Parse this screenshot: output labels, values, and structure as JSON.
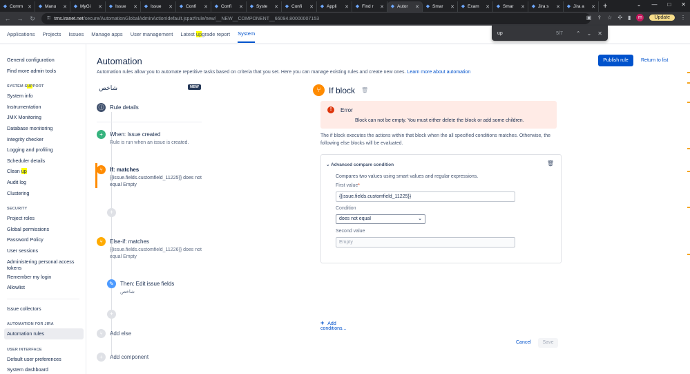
{
  "browser": {
    "tabs": [
      {
        "label": "Comm",
        "active": false
      },
      {
        "label": "Manu",
        "active": false
      },
      {
        "label": "MyGi",
        "active": false
      },
      {
        "label": "Issue",
        "active": false
      },
      {
        "label": "Issue",
        "active": false
      },
      {
        "label": "Confi",
        "active": false
      },
      {
        "label": "Confi",
        "active": false
      },
      {
        "label": "Syste",
        "active": false
      },
      {
        "label": "Confi",
        "active": false
      },
      {
        "label": "Appli",
        "active": false
      },
      {
        "label": "Find r",
        "active": false
      },
      {
        "label": "Autor",
        "active": true
      },
      {
        "label": "Smar",
        "active": false
      },
      {
        "label": "Exam",
        "active": false
      },
      {
        "label": "Smar",
        "active": false
      },
      {
        "label": "Jira s",
        "active": false
      },
      {
        "label": "Jira a",
        "active": false
      }
    ],
    "url_host": "tms.iranet.net",
    "url_path": "/secure/AutomationGlobalAdminAction!default.jspa#/rule/new/__NEW__COMPONENT__66094.80000007153",
    "profile_initial": "m",
    "update_label": "Update",
    "find": {
      "query": "up",
      "count": "5/7"
    }
  },
  "topnav": {
    "items": [
      {
        "pre": "Applications",
        "hl": "",
        "post": ""
      },
      {
        "pre": "Projects",
        "hl": "",
        "post": ""
      },
      {
        "pre": "Issues",
        "hl": "",
        "post": ""
      },
      {
        "pre": "Manage apps",
        "hl": "",
        "post": ""
      },
      {
        "pre": "User management",
        "hl": "",
        "post": ""
      },
      {
        "pre": "Latest ",
        "hl": "up",
        "post": "grade report"
      },
      {
        "pre": "System",
        "hl": "",
        "post": ""
      }
    ]
  },
  "sidebar": {
    "general_configuration": "General configuration",
    "find_more_admin_tools": "Find more admin tools",
    "system_support_pre": "SYSTEM S",
    "system_support_hl": "UP",
    "system_support_post": "PORT",
    "support_items": [
      "System info",
      "Instrumentation",
      "JMX Monitoring",
      "Database monitoring",
      "Integrity checker",
      "Logging and profiling",
      "Scheduler details"
    ],
    "clean_up_pre": "Clean ",
    "clean_up_hl": "up",
    "support_items_2": [
      "Audit log",
      "Clustering"
    ],
    "security_header": "SECURITY",
    "security_items": [
      "Project roles",
      "Global permissions",
      "Password Policy",
      "User sessions"
    ],
    "admin_personal_tokens": "Administering personal access tokens",
    "security_items_2": [
      "Remember my login",
      "Allowlist"
    ],
    "issue_collectors": "Issue collectors",
    "automation_header": "AUTOMATION FOR JIRA",
    "automation_rules": "Automation rules",
    "ui_header": "USER INTERFACE",
    "ui_items": [
      "Default user preferences",
      "System dashboard"
    ]
  },
  "main": {
    "title": "Automation",
    "description": "Automation rules allow you to automate repetitive tasks based on criteria that you set. Here you can manage existing rules and create new ones.",
    "learn_more": "Learn more about automation",
    "publish_label": "Publish rule",
    "return_label": "Return to list",
    "rule_name": "شاخص",
    "new_badge": "NEW",
    "rule_details": "Rule details",
    "trigger_title": "When: Issue created",
    "trigger_desc": "Rule is run when an issue is created.",
    "if_title": "If: matches",
    "if_desc": "{{issue.fields.customfield_11225}} does not equal Empty",
    "elseif_title": "Else-if: matches",
    "elseif_desc": "{{issue.fields.customfield_11226}} does not equal Empty",
    "then_title": "Then: Edit issue fields",
    "then_desc": "شاخص",
    "add_else": "Add else",
    "add_component": "Add component"
  },
  "panel": {
    "title": "If block",
    "error_title": "Error",
    "error_msg": "Block can not be empty. You must either delete the block or add some children.",
    "desc": "The if block executes the actions within that block when the all specified conditions matches. Otherwise, the following else blocks will be evaluated.",
    "cond_title": "Advanced compare condition",
    "cond_desc": "Compares two values using smart values and regular expressions.",
    "first_value_label": "First value",
    "first_value": "{{issue.fields.customfield_11225}}",
    "condition_label": "Condition",
    "condition_value": "does not equal",
    "second_value_label": "Second value",
    "second_value_placeholder": "Empty",
    "add_conditions": "Add conditions...",
    "cancel_label": "Cancel",
    "save_label": "Save"
  },
  "colors": {
    "primary": "#0052cc",
    "if_orange": "#ff8b00",
    "error_bg": "#ffebe6",
    "error_red": "#de350b",
    "trigger_green": "#36b37e",
    "action_blue": "#4c9aff"
  }
}
